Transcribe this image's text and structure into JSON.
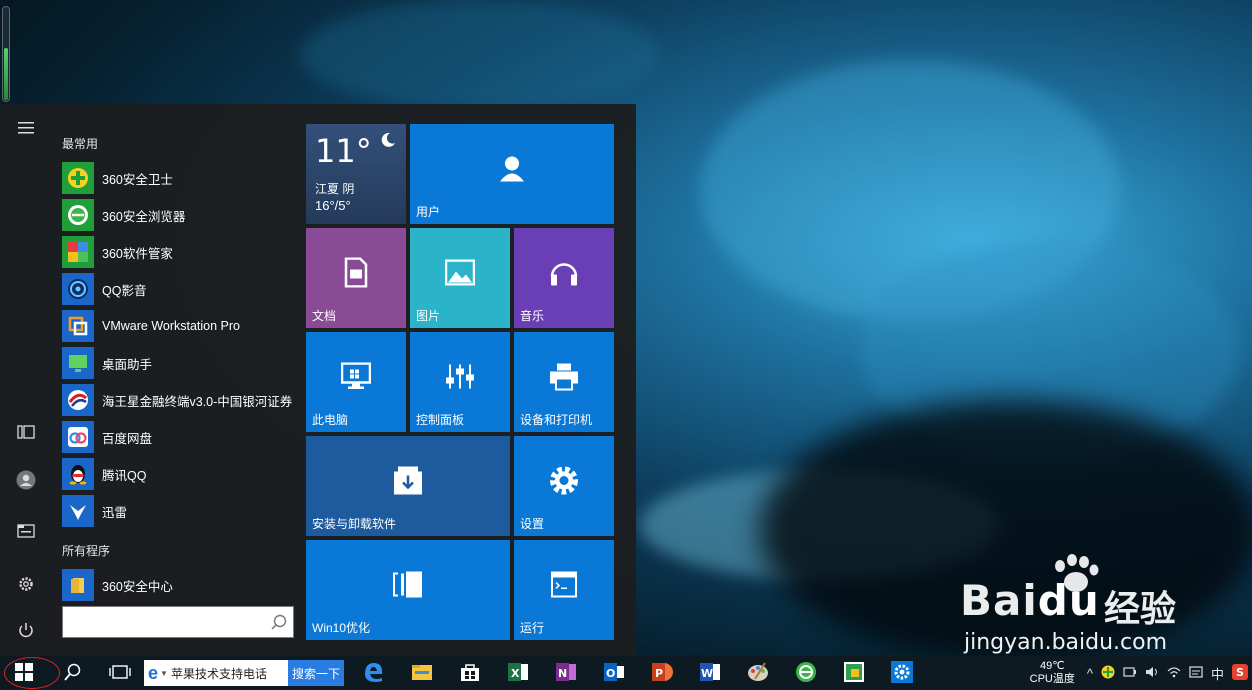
{
  "colors": {
    "tile_blue": "#0a78d7",
    "tile_blue_dark": "#1e5a9e",
    "tile_purple_docs": "#8a4b96",
    "tile_teal_pics": "#2ab3c9",
    "tile_purple_music": "#6a3fb6",
    "weather_bg": "#2c4468",
    "taskbar_bg": "#0d1a22",
    "start_menu_bg": "#1c1e20"
  },
  "start_menu": {
    "most_used_label": "最常用",
    "all_programs_label": "所有程序",
    "most_used": [
      {
        "label": "360安全卫士",
        "icon": "360-safe-guard-icon"
      },
      {
        "label": "360安全浏览器",
        "icon": "360-browser-icon"
      },
      {
        "label": "360软件管家",
        "icon": "360-software-manager-icon"
      },
      {
        "label": "QQ影音",
        "icon": "qq-player-icon"
      },
      {
        "label": "VMware Workstation Pro",
        "icon": "vmware-icon"
      },
      {
        "label": "桌面助手",
        "icon": "desktop-assistant-icon"
      },
      {
        "label": "海王星金融终端v3.0-中国银河证券",
        "icon": "neptune-finance-icon"
      },
      {
        "label": "百度网盘",
        "icon": "baidu-netdisk-icon"
      },
      {
        "label": "腾讯QQ",
        "icon": "tencent-qq-icon"
      },
      {
        "label": "迅雷",
        "icon": "xunlei-icon"
      }
    ],
    "all_programs": [
      {
        "label": "360安全中心",
        "icon": "folder-icon"
      }
    ],
    "search_placeholder": "",
    "rail_icons": [
      "hamburger-icon",
      "tablet-mode-icon",
      "user-avatar-icon",
      "file-explorer-icon",
      "settings-gear-icon",
      "power-icon"
    ]
  },
  "tiles": {
    "weather": {
      "temp": "11°",
      "city": "江夏 阴",
      "range": "16°/5°"
    },
    "user": "用户",
    "docs": "文档",
    "pictures": "图片",
    "music": "音乐",
    "this_pc": "此电脑",
    "control_panel": "控制面板",
    "devices_printers": "设备和打印机",
    "install_uninstall": "安装与卸载软件",
    "settings": "设置",
    "win10_optimize": "Win10优化",
    "run": "运行"
  },
  "taskbar": {
    "ie_text": "苹果技术支持电话",
    "search_button": "搜索一下",
    "apps": [
      "edge-icon",
      "file-explorer-icon",
      "store-icon",
      "excel-icon",
      "onenote-icon",
      "outlook-icon",
      "powerpoint-icon",
      "word-icon",
      "paint-icon",
      "360-browser-icon",
      "photos-icon",
      "settings-gear-icon"
    ],
    "tray": {
      "cpu_temp": "49℃",
      "cpu_label": "CPU温度",
      "ime": "中"
    }
  },
  "watermark": {
    "brand_bai": "Bai",
    "brand_du": "du",
    "brand_jingyan": "经验",
    "url": "jingyan.baidu.com"
  }
}
